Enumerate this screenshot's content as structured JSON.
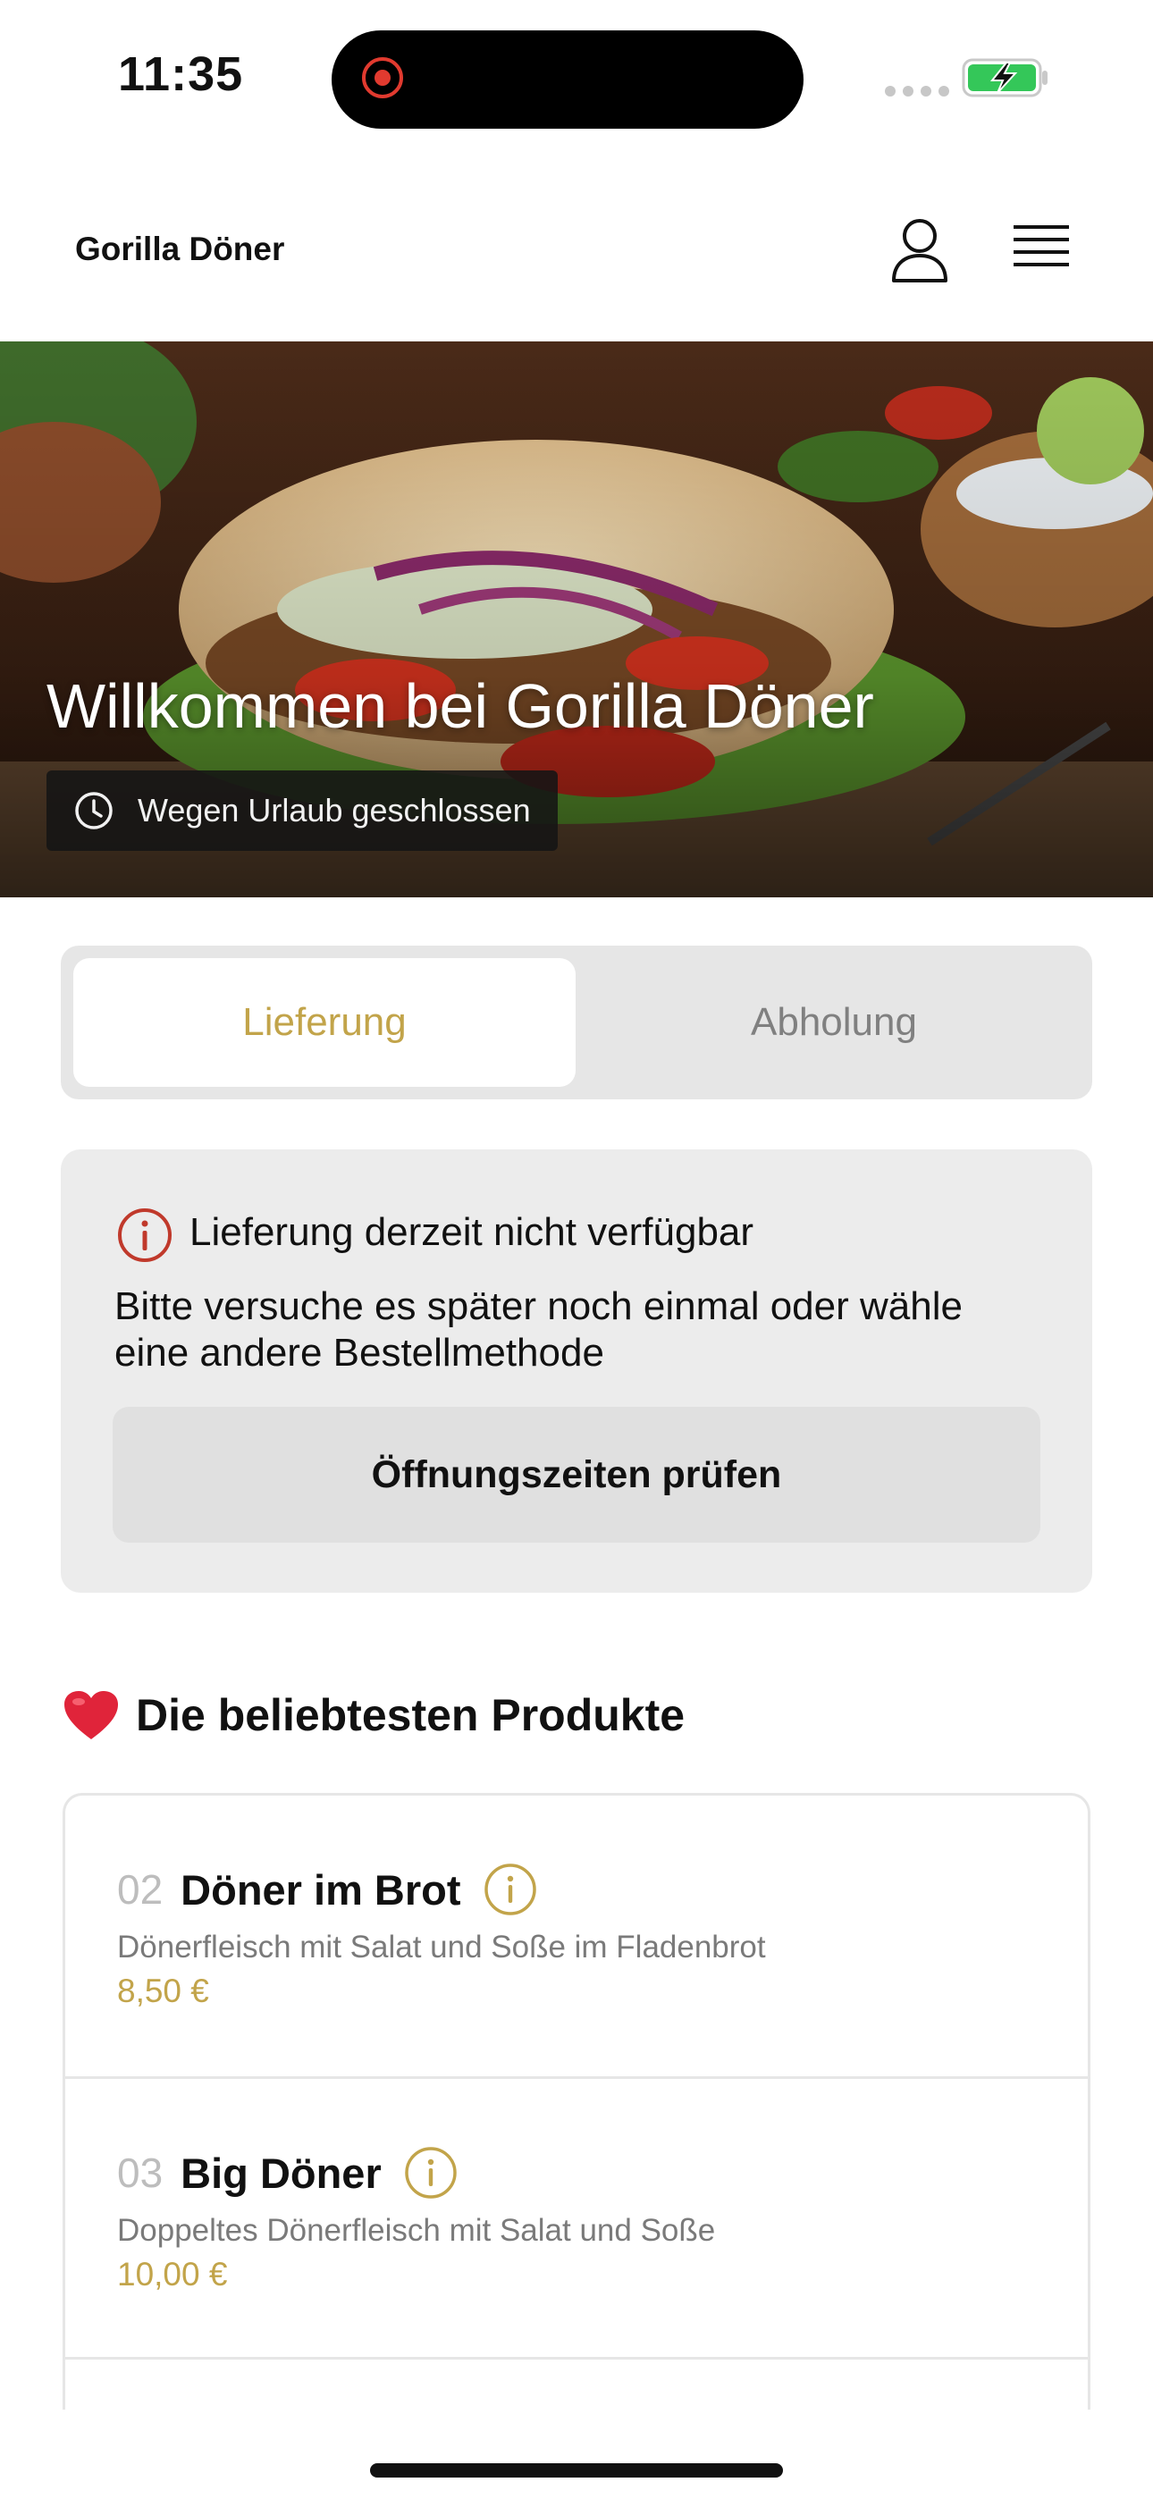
{
  "status_bar": {
    "time": "11:35"
  },
  "header": {
    "brand": "Gorilla Döner"
  },
  "hero": {
    "title": "Willkommen bei Gorilla Döner",
    "status": "Wegen Urlaub geschlossen"
  },
  "order_mode": {
    "tabs": [
      {
        "label": "Lieferung",
        "selected": true
      },
      {
        "label": "Abholung",
        "selected": false
      }
    ]
  },
  "notice": {
    "title": "Lieferung derzeit nicht verfügbar",
    "text": "Bitte versuche es später noch einmal oder wähle eine andere Bestellmethode",
    "button": "Öffnungszeiten prüfen"
  },
  "popular": {
    "title": "Die beliebtesten Produkte",
    "products": [
      {
        "number": "02",
        "name": "Döner im Brot",
        "description": "Dönerfleisch mit Salat und Soße im Fladenbrot",
        "price": "8,50 €"
      },
      {
        "number": "03",
        "name": "Big Döner",
        "description": "Doppeltes Dönerfleisch mit Salat und Soße",
        "price": "10,00 €"
      }
    ]
  },
  "colors": {
    "accent": "#c2a44a",
    "alert": "#c0392b",
    "battery": "#34c759"
  },
  "icons": [
    "record-icon",
    "signal-dots-icon",
    "battery-charging-icon",
    "user-icon",
    "menu-icon",
    "clock-icon",
    "info-circle-icon",
    "heart-emoji-icon"
  ]
}
